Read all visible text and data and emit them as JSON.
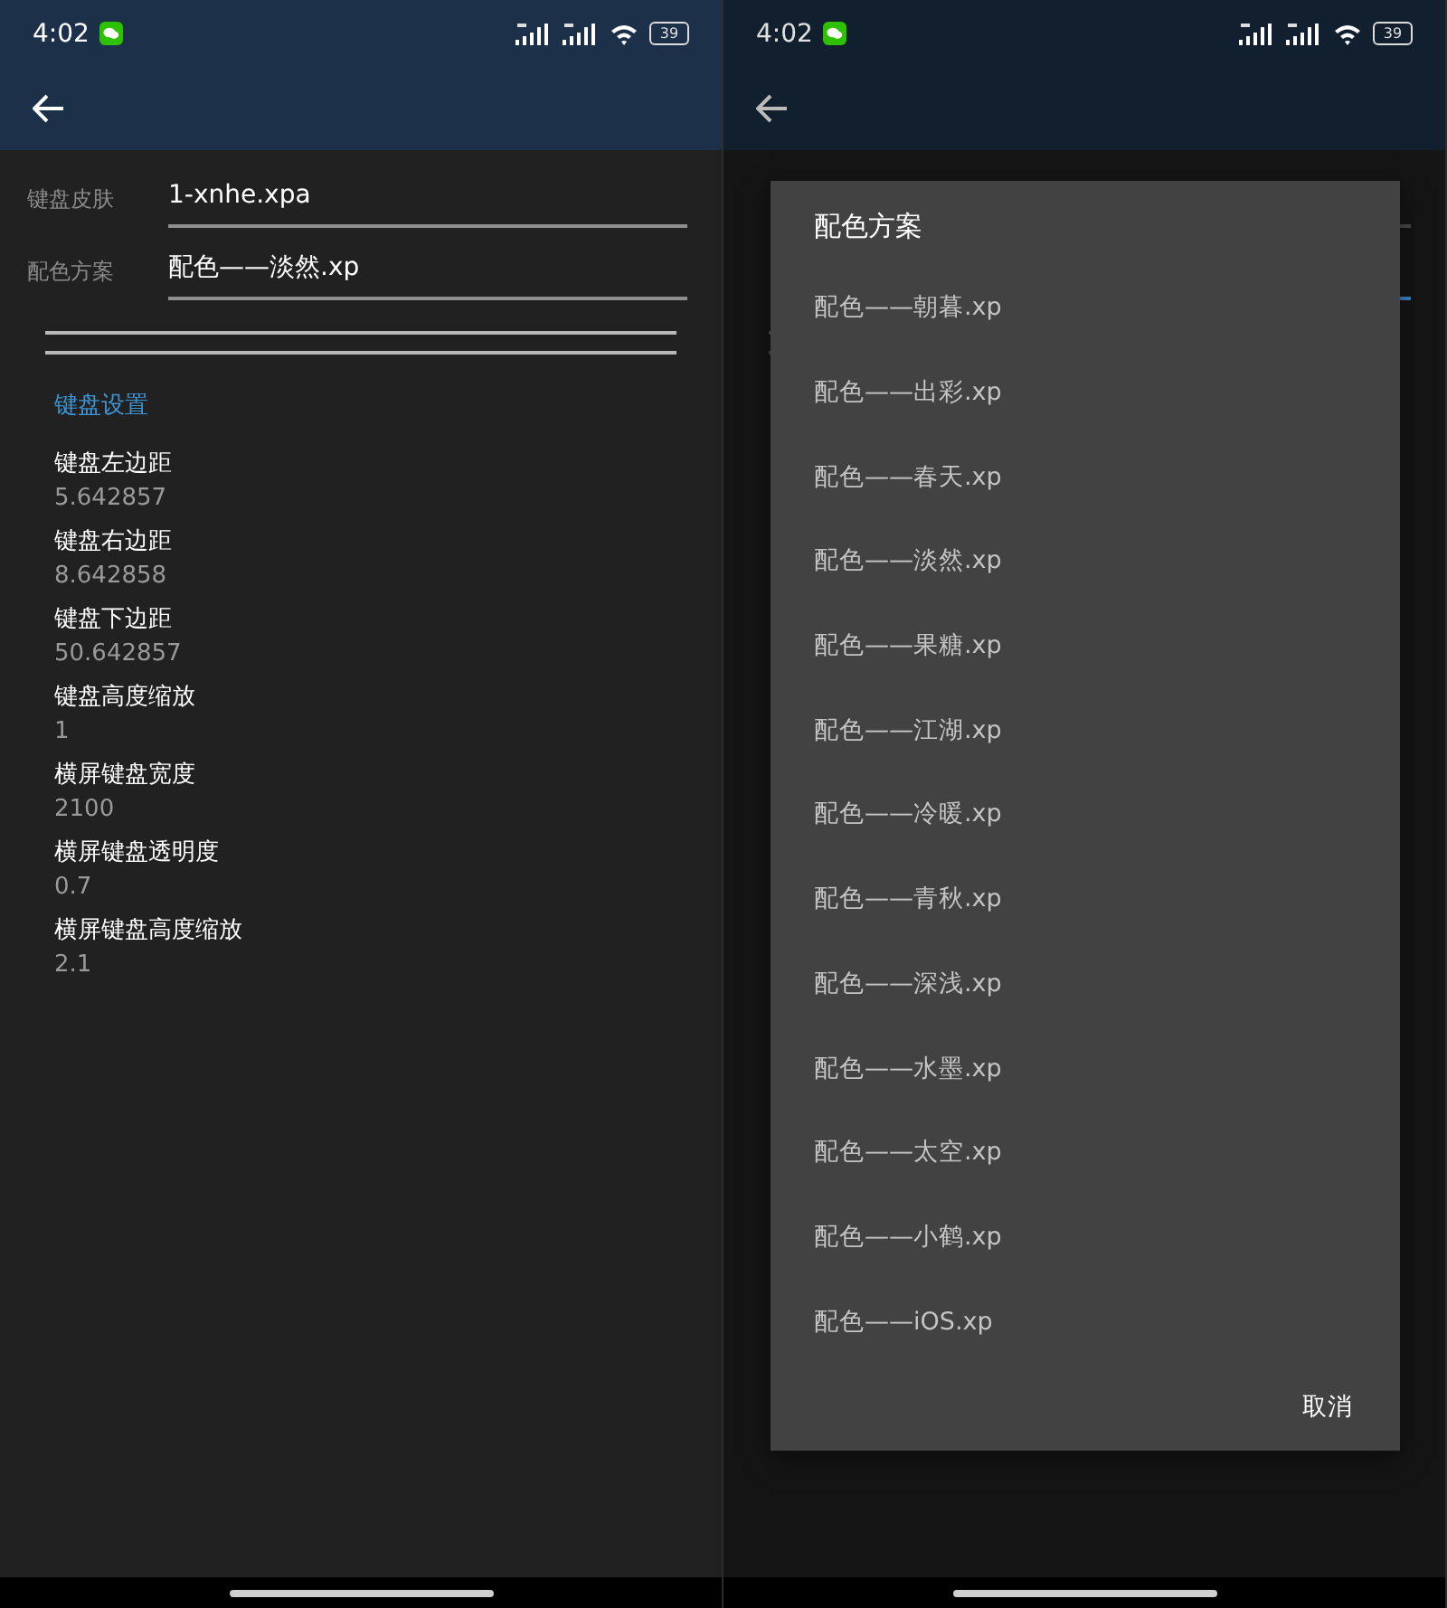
{
  "screens": [
    {
      "status_bar": {
        "time": "4:02",
        "battery": "39"
      },
      "dimmed": false,
      "form": {
        "fields": [
          {
            "label": "键盘皮肤",
            "value": "1-xnhe.xpa",
            "focused": false
          },
          {
            "label": "配色方案",
            "value": "配色——淡然.xp",
            "focused": false
          }
        ],
        "section_title": "键盘设置",
        "settings": [
          {
            "title": "键盘左边距",
            "value": "5.642857"
          },
          {
            "title": "键盘右边距",
            "value": "8.642858"
          },
          {
            "title": "键盘下边距",
            "value": "50.642857"
          },
          {
            "title": "键盘高度缩放",
            "value": "1"
          },
          {
            "title": "横屏键盘宽度",
            "value": "2100"
          },
          {
            "title": "横屏键盘透明度",
            "value": "0.7"
          },
          {
            "title": "横屏键盘高度缩放",
            "value": "2.1"
          }
        ]
      }
    },
    {
      "status_bar": {
        "time": "4:02",
        "battery": "39"
      },
      "dimmed": true,
      "form": {
        "fields": [
          {
            "focused": false
          },
          {
            "focused": true
          }
        ]
      },
      "dialog": {
        "title": "配色方案",
        "options": [
          "配色——朝暮.xp",
          "配色——出彩.xp",
          "配色——春天.xp",
          "配色——淡然.xp",
          "配色——果糖.xp",
          "配色——江湖.xp",
          "配色——冷暖.xp",
          "配色——青秋.xp",
          "配色——深浅.xp",
          "配色——水墨.xp",
          "配色——太空.xp",
          "配色——小鹤.xp",
          "配色——iOS.xp"
        ],
        "button": "取消"
      }
    }
  ]
}
